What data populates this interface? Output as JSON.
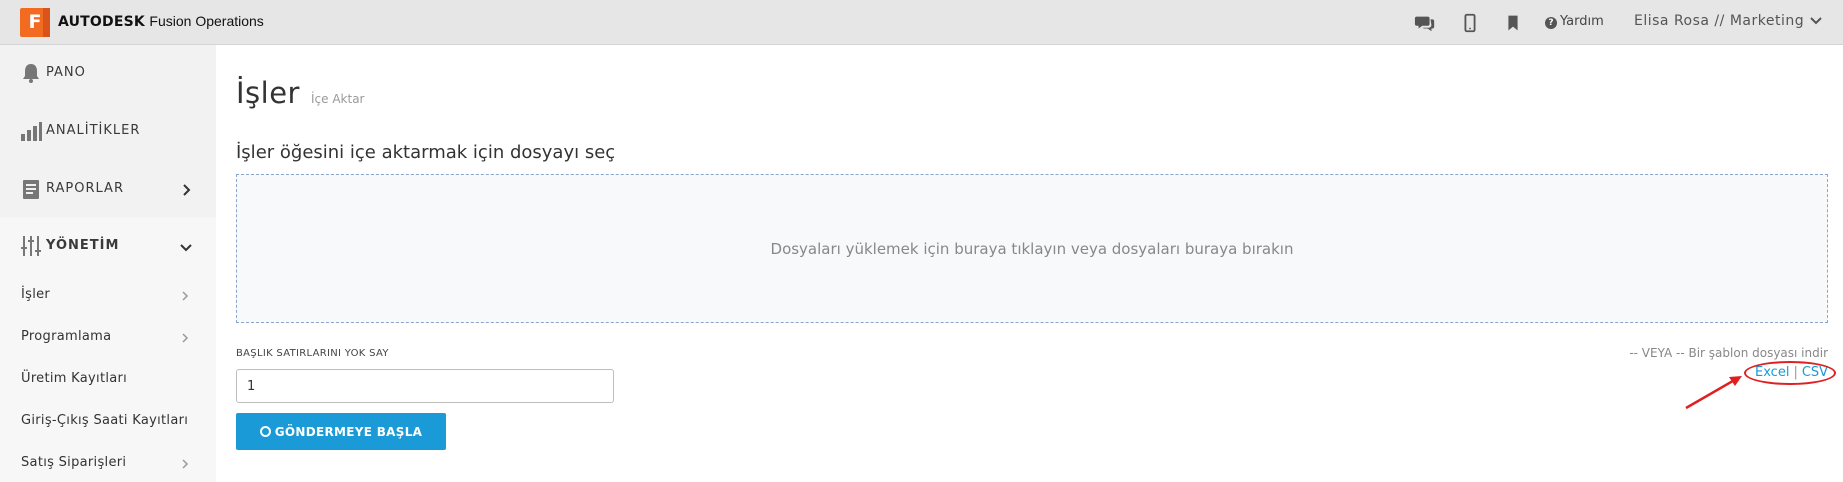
{
  "topbar": {
    "logo_letter": "F",
    "brand_bold": "AUTODESK",
    "brand_product": "Fusion Operations",
    "help_label": "Yardım",
    "user_label": "Elisa Rosa // Marketing",
    "icons": [
      "chat-icon",
      "mobile-icon",
      "bookmark-icon",
      "help-icon",
      "chevron-down-icon"
    ]
  },
  "sidebar": {
    "sections": [
      {
        "label": "PANO",
        "icon": "bell-icon"
      },
      {
        "label": "ANALİTİKLER",
        "icon": "bar-chart-icon"
      },
      {
        "label": "RAPORLAR",
        "icon": "report-icon"
      },
      {
        "label": "YÖNETİM",
        "icon": "sliders-icon"
      }
    ],
    "sub_items": [
      {
        "label": "İşler"
      },
      {
        "label": "Programlama"
      },
      {
        "label": "Üretim Kayıtları"
      },
      {
        "label": "Giriş-Çıkış Saati Kayıtları"
      },
      {
        "label": "Satış Siparişleri"
      }
    ]
  },
  "main": {
    "title": "İşler",
    "subtitle": "İçe Aktar",
    "section_title": "İşler öğesini içe aktarmak için dosyayı seç",
    "dropzone_text": "Dosyaları yüklemek için buraya tıklayın veya dosyaları buraya bırakın",
    "skip_header_label": "BAŞLIK SATIRLARINI YOK SAY",
    "skip_header_value": "1",
    "send_button": "GÖNDERMEYE BAŞLA",
    "template_text": "-- VEYA -- Bir şablon dosyası indir",
    "template_links": {
      "excel": "Excel",
      "separator": "|",
      "csv": "CSV"
    }
  },
  "colors": {
    "accent": "#1a9ad6",
    "logo": "#f26b21",
    "annotation": "#e02020"
  }
}
